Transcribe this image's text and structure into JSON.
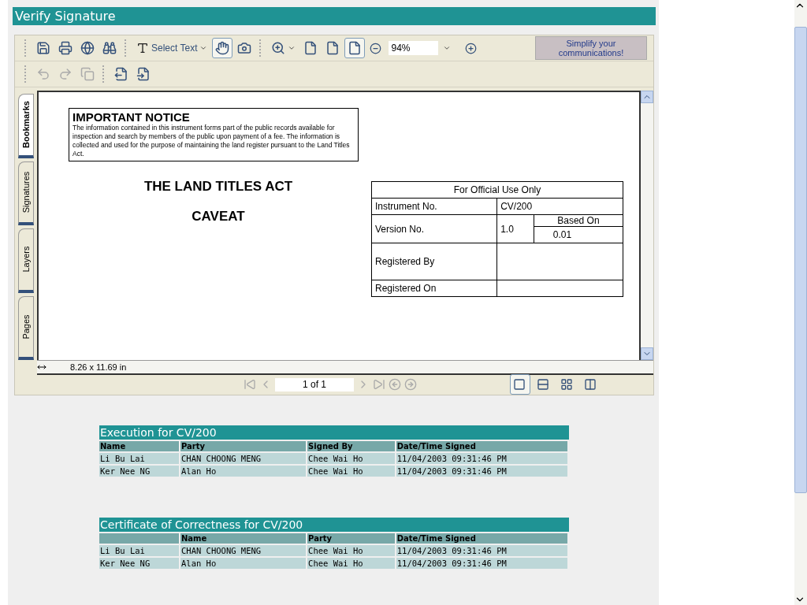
{
  "window": {
    "title": "Verify Signature"
  },
  "toolbar": {
    "tools": [
      {
        "label": "Select Text",
        "selected": false,
        "kind": "text"
      },
      {
        "selected": true,
        "kind": "hand"
      },
      {
        "selected": false,
        "kind": "snapshot"
      }
    ],
    "views": [
      {
        "selected": false
      },
      {
        "selected": false
      },
      {
        "selected": true
      }
    ],
    "zoom": "94%",
    "ad": "Simplify your communications!"
  },
  "side_tabs": [
    {
      "label": "Bookmarks",
      "selected": true
    },
    {
      "label": "Signatures",
      "selected": false
    },
    {
      "label": "Layers",
      "selected": false
    },
    {
      "label": "Pages",
      "selected": false
    }
  ],
  "document": {
    "notice_title": "IMPORTANT NOTICE",
    "notice_text": "The information contained in this instrument forms part of the public records available for inspection and search by members of the public upon payment of a fee. The information is collected and used for the purpose of maintaining the land register pursuant to the Land Titles Act.",
    "act_title": "THE LAND TITLES ACT",
    "doc_type": "CAVEAT",
    "official": {
      "header": "For Official Use Only",
      "instrument_label": "Instrument No.",
      "instrument_no": "CV/200",
      "version_label": "Version No.",
      "version": "1.0",
      "based_on_label": "Based On",
      "based_on": "0.01",
      "registered_by_label": "Registered By",
      "registered_on_label": "Registered On"
    }
  },
  "status": {
    "page_size": "8.26 x 11.69 in",
    "page": "1 of 1",
    "layouts": [
      {
        "selected": true
      },
      {
        "selected": false
      },
      {
        "selected": false
      },
      {
        "selected": false
      }
    ]
  },
  "sections": [
    {
      "title": "Execution for CV/200",
      "columns": [
        "Name",
        "Party",
        "Signed By",
        "Date/Time Signed"
      ],
      "rows": [
        [
          "Li Bu Lai",
          "CHAN CHOONG MENG",
          "Chee Wai Ho",
          "11/04/2003 09:31:46 PM"
        ],
        [
          "Ker Nee NG",
          "Alan Ho",
          "Chee Wai Ho",
          "11/04/2003 09:31:46 PM"
        ]
      ]
    },
    {
      "title": "Certificate of Correctness for CV/200",
      "columns": [
        "",
        "Name",
        "Party",
        "Date/Time Signed"
      ],
      "rows": [
        [
          "Li Bu Lai",
          "CHAN CHOONG MENG",
          "Chee Wai Ho",
          "11/04/2003 09:31:46 PM"
        ],
        [
          "Ker Nee NG",
          "Alan Ho",
          "Chee Wai Ho",
          "11/04/2003 09:31:46 PM"
        ]
      ]
    }
  ]
}
